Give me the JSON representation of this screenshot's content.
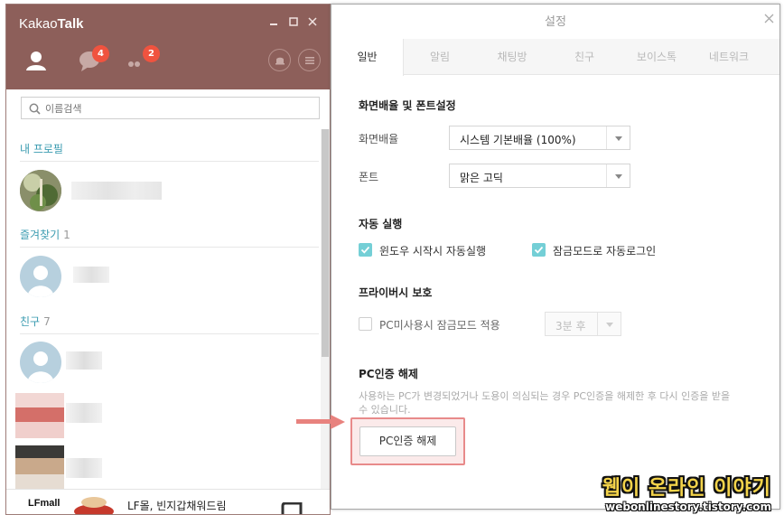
{
  "app": {
    "title_prefix": "Kakao",
    "title_bold": "Talk",
    "tabs": [
      {
        "icon": "friends-icon"
      },
      {
        "icon": "chat-bubble-icon",
        "badge": "4"
      },
      {
        "icon": "more-dots-icon",
        "badge": "2"
      }
    ],
    "header_buttons": [
      "bell-icon",
      "menu-icon"
    ],
    "window_controls": [
      "minimize-icon",
      "maximize-icon",
      "close-icon"
    ]
  },
  "search": {
    "placeholder": "이름검색"
  },
  "friends": {
    "my_profile_title": "내 프로필",
    "favorites_title": "즐겨찾기",
    "favorites_count": "1",
    "friends_title": "친구",
    "friends_count": "7"
  },
  "ad": {
    "brand": "LFmall",
    "text": "LF몰, 빈지갑채워드림"
  },
  "settings": {
    "title": "설정",
    "tabs": [
      "일반",
      "알림",
      "채팅방",
      "친구",
      "보이스톡",
      "네트워크"
    ],
    "active_tab": "일반",
    "display": {
      "heading": "화면배율 및 폰트설정",
      "scale_label": "화면배율",
      "scale_value": "시스템 기본배율 (100%)",
      "font_label": "폰트",
      "font_value": "맑은 고딕"
    },
    "autorun": {
      "heading": "자동 실행",
      "windows_start_label": "윈도우 시작시 자동실행",
      "windows_start_checked": true,
      "lock_autologin_label": "잠금모드로 자동로그인",
      "lock_autologin_checked": true
    },
    "privacy": {
      "heading": "프라이버시 보호",
      "idle_lock_label": "PC미사용시 잠금모드 적용",
      "idle_lock_checked": false,
      "idle_lock_time": "3분 후"
    },
    "pc_auth": {
      "heading": "PC인증 해제",
      "description": "사용하는 PC가 변경되었거나 도용이 의심되는 경우 PC인증을 해제한 후 다시 인증을 받을 수 있습니다.",
      "button_label": "PC인증 해제"
    }
  },
  "watermark": {
    "title": "웹이 온라인 이야기",
    "url": "webonlinestory.tistory.com"
  },
  "colors": {
    "header": "#8d5f5a",
    "badge": "#f0533f",
    "section_title": "#3a9bb0",
    "checkbox": "#74cfd6",
    "highlight_border": "#e88a8a",
    "watermark": "#f3d34a"
  }
}
